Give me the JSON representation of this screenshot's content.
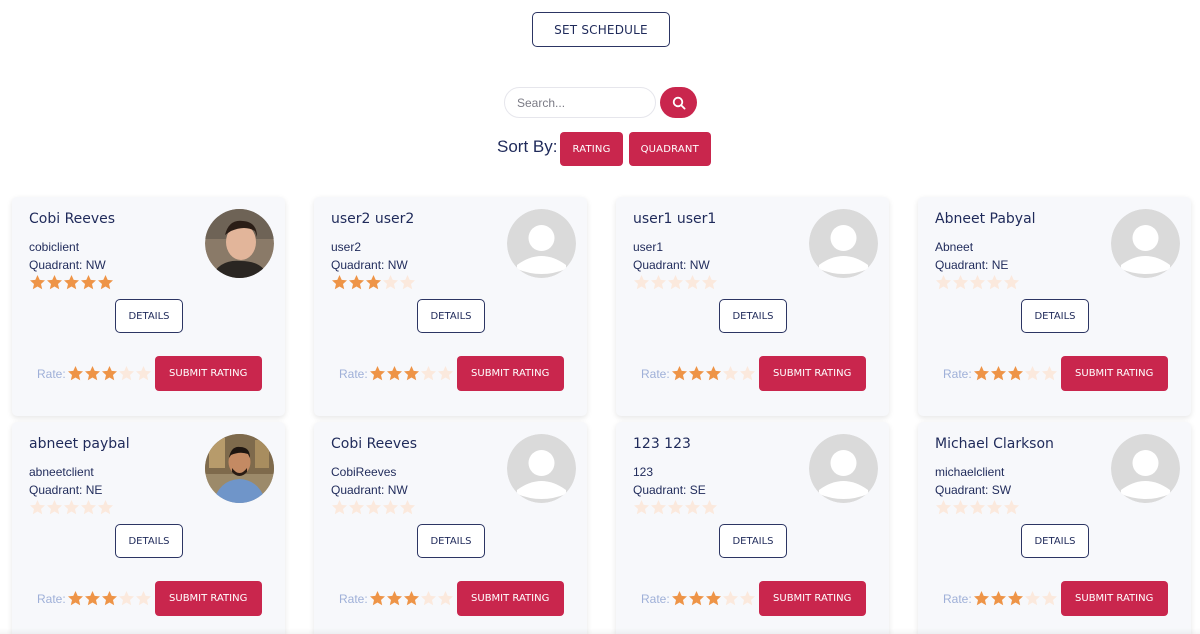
{
  "header": {
    "set_schedule_label": "SET SCHEDULE"
  },
  "search": {
    "placeholder": "Search...",
    "icon": "search-icon"
  },
  "sort": {
    "label": "Sort By:",
    "options": [
      "RATING",
      "QUADRANT"
    ]
  },
  "colors": {
    "accent": "#c9264d",
    "star_on": "#ee9447",
    "star_off": "#fbe9dd",
    "text": "#1f2a5a"
  },
  "cards": [
    {
      "name": "Cobi Reeves",
      "username": "cobiclient",
      "quadrant": "Quadrant: NW",
      "rating": 5,
      "avatar": "photo-male-dark-hair",
      "details": "DETAILS",
      "rate_label": "Rate:",
      "rate_value": 3,
      "submit": "SUBMIT RATING"
    },
    {
      "name": "user2 user2",
      "username": "user2",
      "quadrant": "Quadrant: NW",
      "rating": 3,
      "avatar": "placeholder",
      "details": "DETAILS",
      "rate_label": "Rate:",
      "rate_value": 3,
      "submit": "SUBMIT RATING"
    },
    {
      "name": "user1 user1",
      "username": "user1",
      "quadrant": "Quadrant: NW",
      "rating": 0,
      "avatar": "placeholder",
      "details": "DETAILS",
      "rate_label": "Rate:",
      "rate_value": 3,
      "submit": "SUBMIT RATING"
    },
    {
      "name": "Abneet Pabyal",
      "username": "Abneet",
      "quadrant": "Quadrant: NE",
      "rating": 0,
      "avatar": "placeholder",
      "details": "DETAILS",
      "rate_label": "Rate:",
      "rate_value": 3,
      "submit": "SUBMIT RATING"
    },
    {
      "name": "abneet paybal",
      "username": "abneetclient",
      "quadrant": "Quadrant: NE",
      "rating": 0,
      "avatar": "photo-male-blue-shirt",
      "details": "DETAILS",
      "rate_label": "Rate:",
      "rate_value": 3,
      "submit": "SUBMIT RATING"
    },
    {
      "name": "Cobi Reeves",
      "username": "CobiReeves",
      "quadrant": "Quadrant: NW",
      "rating": 0,
      "avatar": "placeholder",
      "details": "DETAILS",
      "rate_label": "Rate:",
      "rate_value": 3,
      "submit": "SUBMIT RATING"
    },
    {
      "name": "123 123",
      "username": "123",
      "quadrant": "Quadrant: SE",
      "rating": 0,
      "avatar": "placeholder",
      "details": "DETAILS",
      "rate_label": "Rate:",
      "rate_value": 3,
      "submit": "SUBMIT RATING"
    },
    {
      "name": "Michael Clarkson",
      "username": "michaelclient",
      "quadrant": "Quadrant: SW",
      "rating": 0,
      "avatar": "placeholder",
      "details": "DETAILS",
      "rate_label": "Rate:",
      "rate_value": 3,
      "submit": "SUBMIT RATING"
    }
  ]
}
